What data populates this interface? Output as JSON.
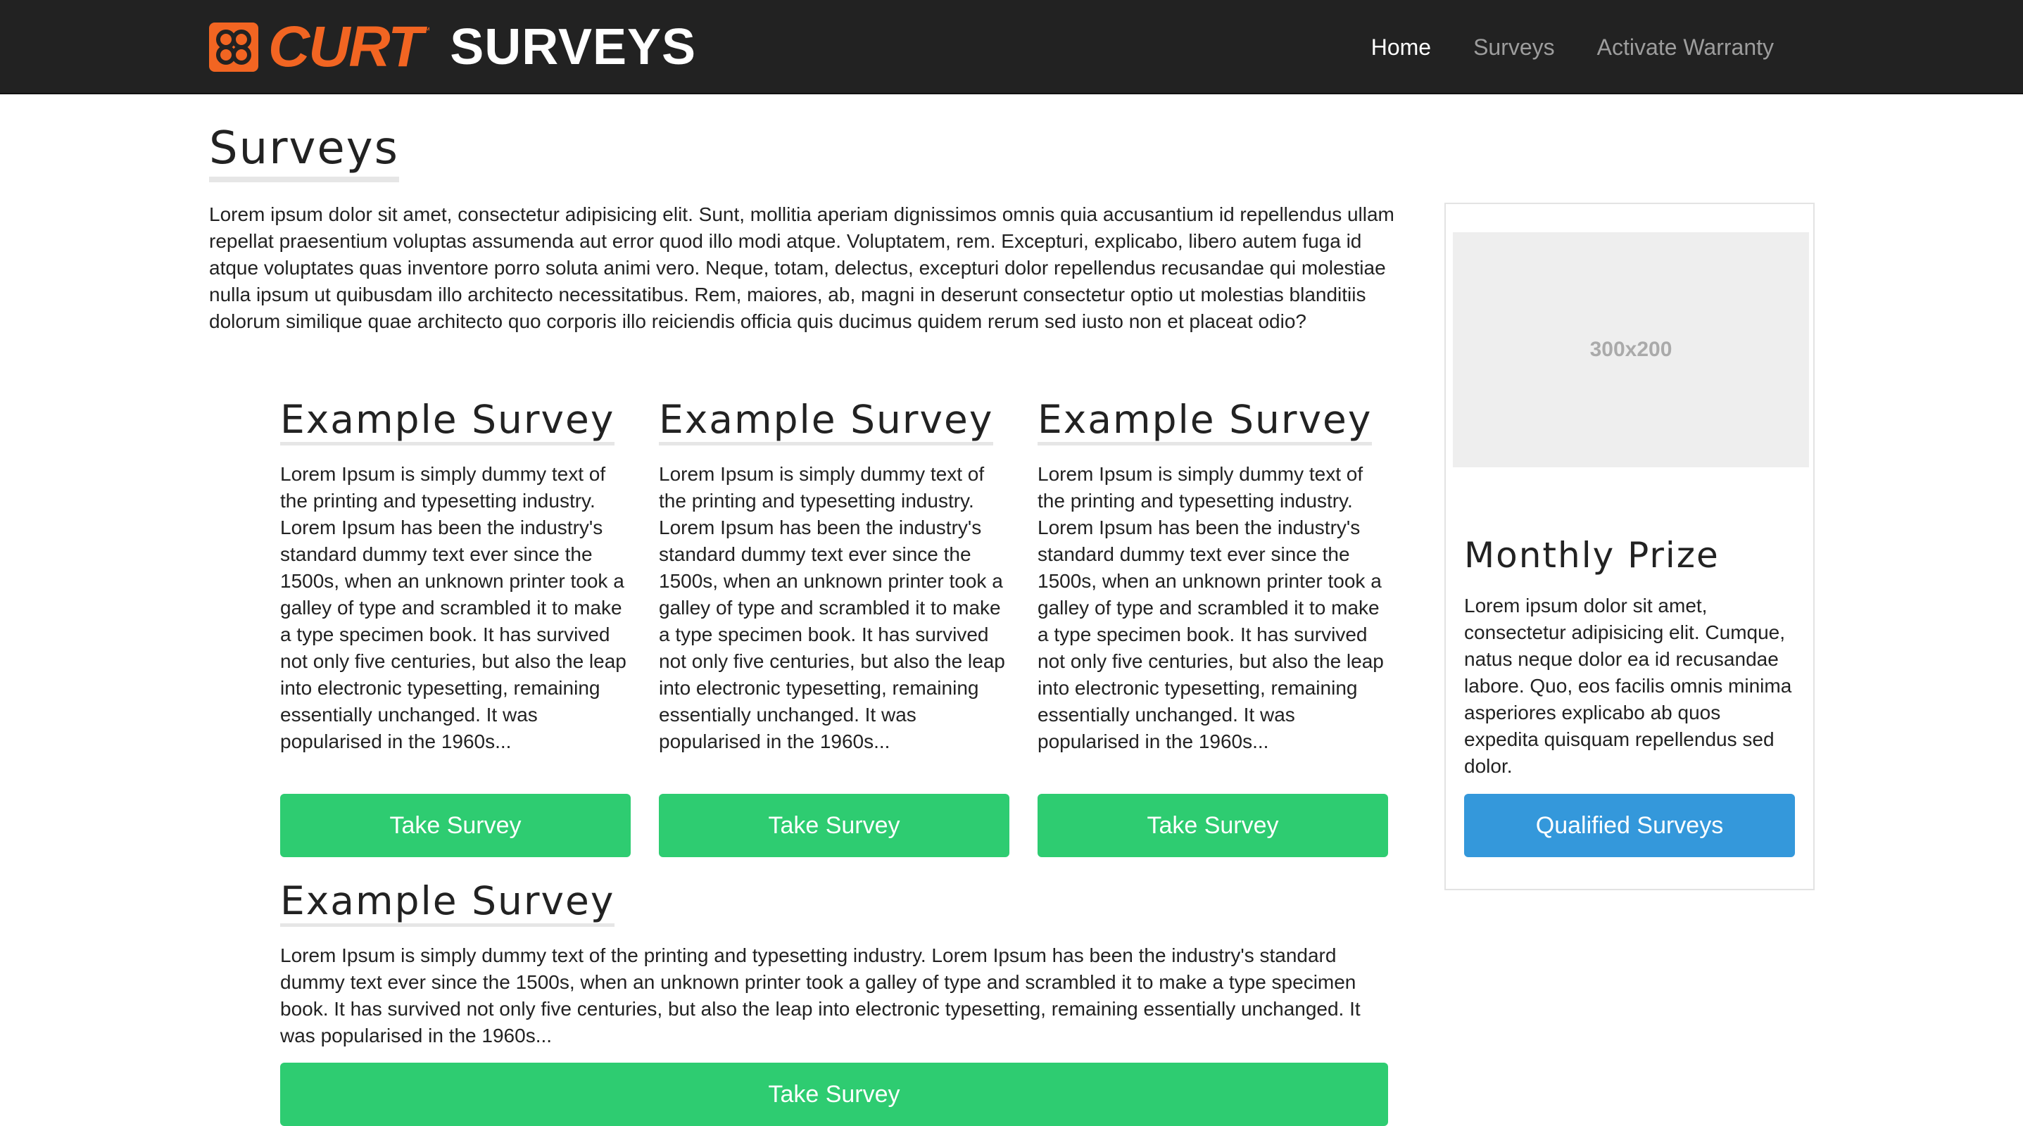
{
  "navbar": {
    "brand_name": "CURT",
    "brand_tm": "™",
    "brand_section": "SURVEYS",
    "brand_color": "#f26522",
    "links": [
      {
        "label": "Home",
        "active": true
      },
      {
        "label": "Surveys",
        "active": false
      },
      {
        "label": "Activate Warranty",
        "active": false
      }
    ]
  },
  "main": {
    "title": "Surveys",
    "intro": "Lorem ipsum dolor sit amet, consectetur adipisicing elit. Sunt, mollitia aperiam dignissimos omnis quia accusantium id repellendus ullam repellat praesentium voluptas assumenda aut error quod illo modi atque. Voluptatem, rem. Excepturi, explicabo, libero autem fuga id atque voluptates quas inventore porro soluta animi vero. Neque, totam, delectus, excepturi dolor repellendus recusandae qui molestiae nulla ipsum ut quibusdam illo architecto necessitatibus. Rem, maiores, ab, magni in deserunt consectetur optio ut molestias blanditiis dolorum similique quae architecto quo corporis illo reiciendis officia quis ducimus quidem rerum sed iusto non et placeat odio?",
    "surveys": [
      {
        "title": "Example Survey",
        "description": "Lorem Ipsum is simply dummy text of the printing and typesetting industry. Lorem Ipsum has been the industry's standard dummy text ever since the 1500s, when an unknown printer took a galley of type and scrambled it to make a type specimen book. It has survived not only five centuries, but also the leap into electronic typesetting, remaining essentially unchanged. It was popularised in the 1960s...",
        "button_label": "Take Survey"
      },
      {
        "title": "Example Survey",
        "description": "Lorem Ipsum is simply dummy text of the printing and typesetting industry. Lorem Ipsum has been the industry's standard dummy text ever since the 1500s, when an unknown printer took a galley of type and scrambled it to make a type specimen book. It has survived not only five centuries, but also the leap into electronic typesetting, remaining essentially unchanged. It was popularised in the 1960s...",
        "button_label": "Take Survey"
      },
      {
        "title": "Example Survey",
        "description": "Lorem Ipsum is simply dummy text of the printing and typesetting industry. Lorem Ipsum has been the industry's standard dummy text ever since the 1500s, when an unknown printer took a galley of type and scrambled it to make a type specimen book. It has survived not only five centuries, but also the leap into electronic typesetting, remaining essentially unchanged. It was popularised in the 1960s...",
        "button_label": "Take Survey"
      },
      {
        "title": "Example Survey",
        "description": "Lorem Ipsum is simply dummy text of the printing and typesetting industry. Lorem Ipsum has been the industry's standard dummy text ever since the 1500s, when an unknown printer took a galley of type and scrambled it to make a type specimen book. It has survived not only five centuries, but also the leap into electronic typesetting, remaining essentially unchanged. It was popularised in the 1960s...",
        "button_label": "Take Survey"
      }
    ]
  },
  "sidebar": {
    "placeholder_label": "300x200",
    "title": "Monthly Prize",
    "text": "Lorem ipsum dolor sit amet, consectetur adipisicing elit. Cumque, natus neque dolor ea id recusandae labore. Quo, eos facilis omnis minima asperiores explicabo ab quos expedita quisquam repellendus sed dolor.",
    "button_label": "Qualified Surveys"
  },
  "colors": {
    "navbar_bg": "#222222",
    "take_survey_button": "#2ecc71",
    "qualified_button": "#3498db"
  }
}
